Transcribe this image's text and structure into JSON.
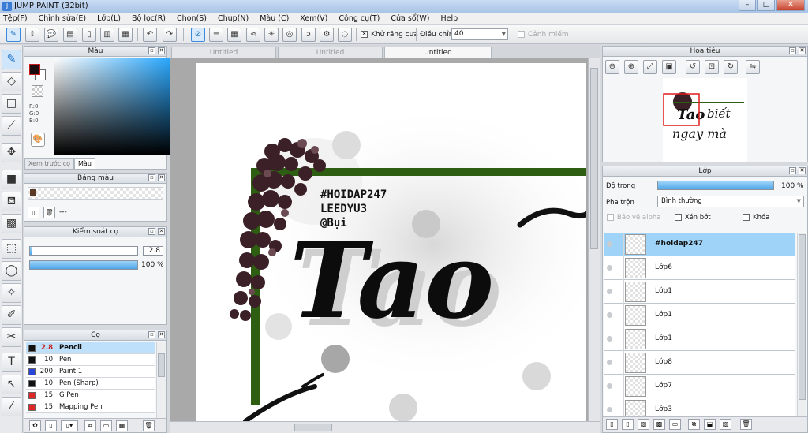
{
  "window": {
    "title": "JUMP PAINT (32bit)",
    "minimize": "–",
    "maximize": "□",
    "close": "✕"
  },
  "menu": [
    "Tệp(F)",
    "Chỉnh sửa(E)",
    "Lớp(L)",
    "Bộ lọc(R)",
    "Chọn(S)",
    "Chụp(N)",
    "Màu (C)",
    "Xem(V)",
    "Công cụ(T)",
    "Cửa sổ(W)",
    "Help"
  ],
  "toolbar": {
    "antialias_label": "Khử răng cưa",
    "adjust_label": "Điều chỉnh",
    "adjust_value": "40",
    "warning_label": "Cảnh miếm"
  },
  "color_panel": {
    "title": "Màu",
    "r_label": "R:0",
    "g_label": "G:0",
    "b_label": "B:0",
    "tabs": [
      "Xem trước cọ",
      "Màu"
    ],
    "active_tab": "Màu",
    "foreground": "#1a0c0c",
    "background": "#ffffff"
  },
  "palette_panel": {
    "title": "Bảng màu",
    "placeholder": "---"
  },
  "brush_control": {
    "title": "Kiểm soát cọ",
    "size_value": "2.8",
    "opacity_value": "100 %"
  },
  "brushes": {
    "title": "Cọ",
    "items": [
      {
        "size": "2.8",
        "name": "Pencil",
        "color": "#111111",
        "selected": true
      },
      {
        "size": "10",
        "name": "Pen",
        "color": "#111111",
        "selected": false
      },
      {
        "size": "200",
        "name": "Paint 1",
        "color": "#2b45d8",
        "selected": false
      },
      {
        "size": "10",
        "name": "Pen (Sharp)",
        "color": "#111111",
        "selected": false
      },
      {
        "size": "15",
        "name": "G Pen",
        "color": "#e02626",
        "selected": false
      },
      {
        "size": "15",
        "name": "Mapping Pen",
        "color": "#e02626",
        "selected": false
      }
    ]
  },
  "doc_tabs": [
    "Untitled",
    "Untitled",
    "Untitled"
  ],
  "artwork": {
    "tag_line1": "#HOIDAP247",
    "tag_line2": "LEEDYU3",
    "tag_line3": "@Bụi",
    "lettering": "Tao"
  },
  "navigator": {
    "title": "Hoa tiêu",
    "preview_word1": "Tao",
    "preview_word2": "biết",
    "preview_word3": "ngay mà"
  },
  "layers": {
    "title": "Lớp",
    "opacity_label": "Độ trong",
    "opacity_value": "100 %",
    "opacity_level": 1.0,
    "blend_label": "Pha trộn",
    "blend_value": "Bình thường",
    "protect_alpha_label": "Bảo vệ alpha",
    "clipping_label": "Xén bớt",
    "lock_label": "Khóa",
    "items": [
      {
        "name": "#hoidap247",
        "selected": true
      },
      {
        "name": "Lớp6",
        "selected": false
      },
      {
        "name": "Lớp1",
        "selected": false
      },
      {
        "name": "Lớp1",
        "selected": false
      },
      {
        "name": "Lớp1",
        "selected": false
      },
      {
        "name": "Lớp8",
        "selected": false
      },
      {
        "name": "Lớp7",
        "selected": false
      },
      {
        "name": "Lớp3",
        "selected": false
      }
    ]
  },
  "colors": {
    "accent": "#3b8ad9",
    "selection": "#9fd4f8",
    "frame_green": "#2e5e12"
  }
}
